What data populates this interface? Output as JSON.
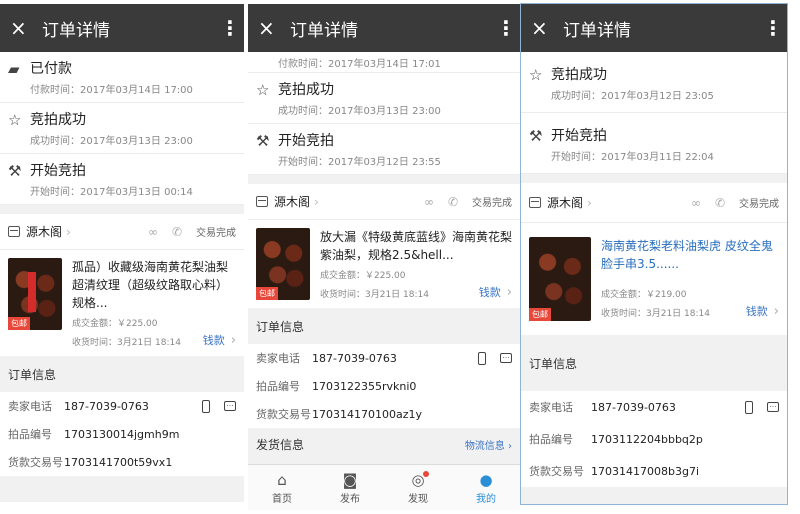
{
  "header": {
    "close_icon": "×",
    "title": "订单详情",
    "more_icon": "⋮"
  },
  "panel1": {
    "events": [
      {
        "icon": "wallet-icon",
        "glyph": "▰",
        "title": "已付款",
        "time": "付款时间：2017年03月14日 17:00"
      },
      {
        "icon": "star-icon",
        "glyph": "☆",
        "title": "竞拍成功",
        "time": "成功时间：2017年03月13日 23:00"
      },
      {
        "icon": "gavel-icon",
        "glyph": "⚒",
        "title": "开始竞拍",
        "time": "开始时间：2017年03月13日 00:14"
      }
    ],
    "shop": {
      "name": "源木阁",
      "status": "交易完成"
    },
    "item": {
      "name": "孤品）收藏级海南黄花梨油梨超清纹理（超级纹路取心料）规格...",
      "tag": "包邮",
      "price": "成交金额：￥225.00",
      "receive": "收货时间：3月21日 18:14",
      "pay_label": "钱款"
    },
    "order_title": "订单信息",
    "rows": [
      {
        "k": "卖家电话",
        "v": "187-7039-0763"
      },
      {
        "k": "拍品编号",
        "v": "1703130014jgmh9m"
      },
      {
        "k": "货款交易号",
        "v": "1703141700t59vx1"
      }
    ]
  },
  "panel2": {
    "top_time": "付款时间：2017年03月14日 17:01",
    "events": [
      {
        "icon": "star-icon",
        "glyph": "☆",
        "title": "竞拍成功",
        "time": "成功时间：2017年03月13日 23:00"
      },
      {
        "icon": "gavel-icon",
        "glyph": "⚒",
        "title": "开始竞拍",
        "time": "开始时间：2017年03月12日 23:55"
      }
    ],
    "shop": {
      "name": "源木阁",
      "status": "交易完成"
    },
    "item": {
      "name": "放大漏《特级黄底蓝线》海南黄花梨紫油梨，规格2.5&hell...",
      "tag": "包邮",
      "price": "成交金额：￥225.00",
      "receive": "收货时间：3月21日 18:14",
      "pay_label": "钱款"
    },
    "order_title": "订单信息",
    "rows": [
      {
        "k": "卖家电话",
        "v": "187-7039-0763"
      },
      {
        "k": "拍品编号",
        "v": "1703122355rvkni0"
      },
      {
        "k": "货款交易号",
        "v": "1703141701​00az1y"
      }
    ],
    "ship_title": "发货信息",
    "ship_link": "物流信息 ›",
    "tabs": [
      {
        "icon": "home-icon",
        "glyph": "⌂",
        "label": "首页"
      },
      {
        "icon": "camera-icon",
        "glyph": "◙",
        "label": "发布"
      },
      {
        "icon": "compass-icon",
        "glyph": "◎",
        "label": "发现"
      },
      {
        "icon": "profile-icon",
        "glyph": "●",
        "label": "我的"
      }
    ]
  },
  "panel3": {
    "events": [
      {
        "icon": "star-icon",
        "glyph": "☆",
        "title": "竞拍成功",
        "time": "成功时间：2017年03月12日 23:05"
      },
      {
        "icon": "gavel-icon",
        "glyph": "⚒",
        "title": "开始竞拍",
        "time": "开始时间：2017年03月11日 22:04"
      }
    ],
    "shop": {
      "name": "源木阁",
      "status": "交易完成"
    },
    "item": {
      "name": "海南黄花梨老料油梨虎 皮纹全鬼脸手串3.5......",
      "tag": "包邮",
      "price": "成交金额：￥219.00",
      "receive": "收货时间：3月21日 18:14",
      "pay_label": "钱款"
    },
    "order_title": "订单信息",
    "rows": [
      {
        "k": "卖家电话",
        "v": "187-7039-0763"
      },
      {
        "k": "拍品编号",
        "v": "1703112204bbbq2p"
      },
      {
        "k": "货款交易号",
        "v": "17031417008b3g7i"
      }
    ]
  }
}
